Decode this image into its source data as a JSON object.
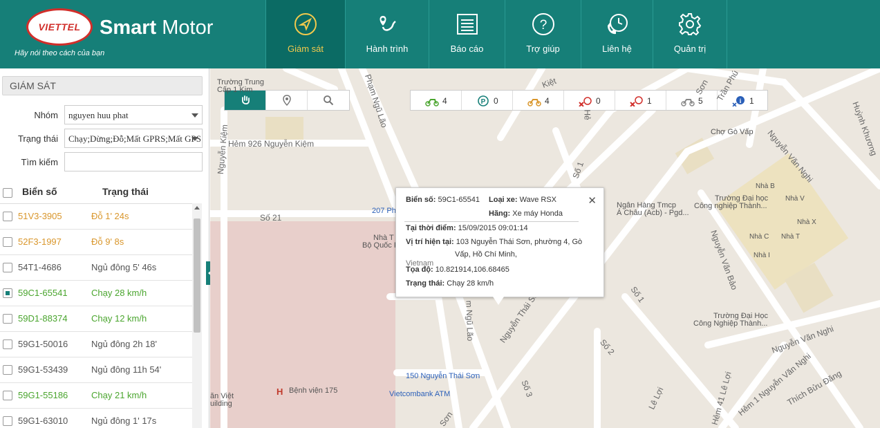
{
  "header": {
    "logo_text": "VIETTEL",
    "brand_bold": "Smart",
    "brand_light": " Motor",
    "slogan": "Hãy nói theo cách của bạn",
    "nav": [
      {
        "label": "Giám sát",
        "icon": "compass-icon"
      },
      {
        "label": "Hành trình",
        "icon": "route-icon"
      },
      {
        "label": "Báo cáo",
        "icon": "report-icon"
      },
      {
        "label": "Trợ giúp",
        "icon": "help-icon"
      },
      {
        "label": "Liên hệ",
        "icon": "contact-icon"
      },
      {
        "label": "Quản trị",
        "icon": "gear-icon"
      }
    ]
  },
  "sidebar": {
    "title": "GIÁM SÁT",
    "group_label": "Nhóm",
    "group_value": "nguyen huu phat",
    "status_label": "Trạng thái",
    "status_value": "Chạy;Dừng;Đỗ;Mất GPRS;Mất GPS",
    "search_label": "Tìm kiếm",
    "search_value": "",
    "col_plate": "Biển số",
    "col_status": "Trạng thái",
    "rows": [
      {
        "plate": "51V3-3905",
        "status": "Đỗ 1' 24s",
        "color": "#d9962b",
        "checked": false
      },
      {
        "plate": "52F3-1997",
        "status": "Đỗ 9' 8s",
        "color": "#d9962b",
        "checked": false
      },
      {
        "plate": "54T1-4686",
        "status": "Ngủ đông 5' 46s",
        "color": "#555555",
        "checked": false
      },
      {
        "plate": "59C1-65541",
        "status": "Chạy 28 km/h",
        "color": "#4aa52e",
        "checked": true
      },
      {
        "plate": "59D1-88374",
        "status": "Chạy 12 km/h",
        "color": "#4aa52e",
        "checked": false
      },
      {
        "plate": "59G1-50016",
        "status": "Ngủ đông 2h 18'",
        "color": "#555555",
        "checked": false
      },
      {
        "plate": "59G1-53439",
        "status": "Ngủ đông 11h 54'",
        "color": "#555555",
        "checked": false
      },
      {
        "plate": "59G1-55186",
        "status": "Chạy 21 km/h",
        "color": "#4aa52e",
        "checked": false
      },
      {
        "plate": "59G1-63010",
        "status": "Ngủ đông 1' 17s",
        "color": "#555555",
        "checked": false
      }
    ]
  },
  "map": {
    "tools": [
      "hand-icon",
      "marker-icon",
      "search-icon"
    ],
    "stats": [
      {
        "icon": "moto-running-icon",
        "count": "4",
        "color": "#4aa52e"
      },
      {
        "icon": "parking-icon",
        "count": "0",
        "color": "#167f78"
      },
      {
        "icon": "moto-stopped-icon",
        "count": "4",
        "color": "#d9962b"
      },
      {
        "icon": "moto-no-gprs-icon",
        "count": "0",
        "color": "#d12e2a"
      },
      {
        "icon": "no-gps-icon",
        "count": "1",
        "color": "#d12e2a"
      },
      {
        "icon": "moto-hibernate-icon",
        "count": "5",
        "color": "#888888"
      },
      {
        "icon": "info-icon",
        "count": "1",
        "color": "#2a5fb8"
      }
    ],
    "popup": {
      "plate_label": "Biển số:",
      "plate": "59C1-65541",
      "type_label": "Loại xe:",
      "type": "Wave RSX",
      "brand_label": "Hãng:",
      "brand": "Xe máy Honda",
      "time_label": "Tại thời điểm:",
      "time": "15/09/2015 09:01:14",
      "loc_label": "Vị trí hiện tại:",
      "loc_1": "103 Nguyễn Thái Sơn, phường 4, Gò",
      "loc_2": "Vấp, Hồ Chí Minh,",
      "loc_3": "Vietnam",
      "coord_label": "Tọa độ:",
      "coord": "10.821914,106.68465",
      "status_label": "Trạng thái:",
      "status": "Chạy 28 km/h"
    },
    "labels": {
      "school_trung": "Trường Trung",
      "school_cap": "Cấp 1 Kim",
      "hem926": "Hẻm 926 Nguyễn Kiệm",
      "pham_ngu_lao": "Phạm Ngũ Lão",
      "nguyen_kiem": "Nguyễn Kiệm",
      "so21": "Số 21",
      "bld207": "207 Ph",
      "nha_t": "Nhà T",
      "bo_quoc": "Bộ Quốc P",
      "bank": "Ngân Hàng Tmcp",
      "bank2": "Á Châu (Acb) - Pgd...",
      "cho": "Chợ Gò Vấp",
      "truong_dh": "Trường Đại học",
      "cnt": "Công nghiệp Thành...",
      "truong_dh2": "Trường Đại Học",
      "cnt2": "Công Nghiệp Thành...",
      "nha_b": "Nhà B",
      "nha_v": "Nhà V",
      "nha_x": "Nhà X",
      "nha_c": "Nhà C",
      "nha_t2": "Nhà T",
      "nha_i": "Nhà I",
      "nguyen_thai_son": "Nguyễn Thái Sơn",
      "nguyen_van_bao": "Nguyễn Văn Bảo",
      "nguyen_van_nghi": "Nguyễn Văn Nghi",
      "nguyen_van_nghi2": "Nguyễn Văn Nghi",
      "hem1": "Hẻm 1 Nguyễn Văn Nghi",
      "hem41": "Hẻm 41 Lê Lợi",
      "le_loi": "Lê Lợi",
      "thich": "Thích Bửu Đăng",
      "so1": "Số 1",
      "so1b": "Số 1",
      "so2": "Số 2",
      "so3": "Số 3",
      "ngu_lao": "m Ngũ Lão",
      "addr150": "150 Nguyễn Thái Sơn",
      "vietcombank": "Vietcombank ATM",
      "bv175": "Bệnh viện 175",
      "an_viet": "ăn Việt",
      "uilding": "uilding",
      "tran_pho": "Trần Phú",
      "huynh": "Huỳnh Khương",
      "kiet": "Kiệt",
      "son": "Sơn",
      "hen": "Hẻ",
      "so_son": "Sơn"
    }
  }
}
